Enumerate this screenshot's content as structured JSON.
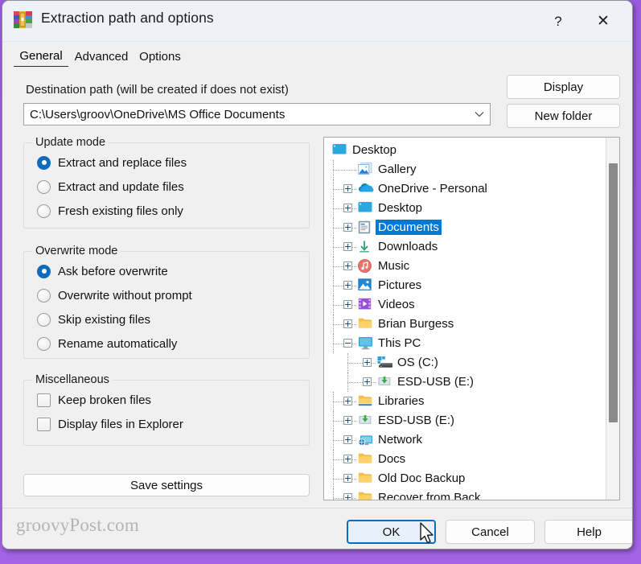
{
  "window": {
    "title": "Extraction path and options",
    "icon": "winrar-books-icon",
    "help_label": "?",
    "close_label": "✕"
  },
  "tabs": [
    {
      "label": "General",
      "active": true
    },
    {
      "label": "Advanced",
      "active": false
    },
    {
      "label": "Options",
      "active": false
    }
  ],
  "destination": {
    "label": "Destination path (will be created if does not exist)",
    "value": "C:\\Users\\groov\\OneDrive\\MS Office Documents",
    "placeholder": "Destination path",
    "dropdown_arrow": "∨"
  },
  "side_buttons": {
    "display": "Display",
    "new_folder": "New folder"
  },
  "update_mode": {
    "title": "Update mode",
    "options": [
      {
        "label": "Extract and replace files",
        "selected": true
      },
      {
        "label": "Extract and update files",
        "selected": false
      },
      {
        "label": "Fresh existing files only",
        "selected": false
      }
    ]
  },
  "overwrite_mode": {
    "title": "Overwrite mode",
    "options": [
      {
        "label": "Ask before overwrite",
        "selected": true
      },
      {
        "label": "Overwrite without prompt",
        "selected": false
      },
      {
        "label": "Skip existing files",
        "selected": false
      },
      {
        "label": "Rename automatically",
        "selected": false
      }
    ]
  },
  "miscellaneous": {
    "title": "Miscellaneous",
    "options": [
      {
        "label": "Keep broken files",
        "checked": false
      },
      {
        "label": "Display files in Explorer",
        "checked": false
      }
    ]
  },
  "save_settings_label": "Save settings",
  "tree": {
    "selected": "Documents",
    "scrollbar": "vertical-scrollbar",
    "items": [
      {
        "label": "Desktop",
        "depth": 0,
        "expander": "none",
        "icon": "desktop-icon"
      },
      {
        "label": "Gallery",
        "depth": 1,
        "expander": "none",
        "icon": "gallery-icon"
      },
      {
        "label": "OneDrive - Personal",
        "depth": 1,
        "expander": "plus",
        "icon": "onedrive-icon"
      },
      {
        "label": "Desktop",
        "depth": 1,
        "expander": "plus",
        "icon": "desktop-icon"
      },
      {
        "label": "Documents",
        "depth": 1,
        "expander": "plus",
        "icon": "documents-icon",
        "selected": true
      },
      {
        "label": "Downloads",
        "depth": 1,
        "expander": "plus",
        "icon": "downloads-icon"
      },
      {
        "label": "Music",
        "depth": 1,
        "expander": "plus",
        "icon": "music-icon"
      },
      {
        "label": "Pictures",
        "depth": 1,
        "expander": "plus",
        "icon": "pictures-icon"
      },
      {
        "label": "Videos",
        "depth": 1,
        "expander": "plus",
        "icon": "videos-icon"
      },
      {
        "label": "Brian Burgess",
        "depth": 1,
        "expander": "plus",
        "icon": "folder-icon"
      },
      {
        "label": "This PC",
        "depth": 1,
        "expander": "minus",
        "icon": "this-pc-icon"
      },
      {
        "label": "OS (C:)",
        "depth": 2,
        "expander": "plus",
        "icon": "hard-drive-icon"
      },
      {
        "label": "ESD-USB (E:)",
        "depth": 2,
        "expander": "plus",
        "icon": "usb-drive-icon"
      },
      {
        "label": "Libraries",
        "depth": 1,
        "expander": "plus",
        "icon": "libraries-icon"
      },
      {
        "label": "ESD-USB (E:)",
        "depth": 1,
        "expander": "plus",
        "icon": "usb-drive-icon"
      },
      {
        "label": "Network",
        "depth": 1,
        "expander": "plus",
        "icon": "network-icon"
      },
      {
        "label": "Docs",
        "depth": 1,
        "expander": "plus",
        "icon": "folder-icon"
      },
      {
        "label": "Old Doc Backup",
        "depth": 1,
        "expander": "plus",
        "icon": "folder-icon"
      },
      {
        "label": "Recover from Back",
        "depth": 1,
        "expander": "plus",
        "icon": "folder-icon",
        "clipped": true
      }
    ]
  },
  "footer": {
    "watermark": "groovyPost.com",
    "ok": "OK",
    "cancel": "Cancel",
    "help": "Help"
  }
}
